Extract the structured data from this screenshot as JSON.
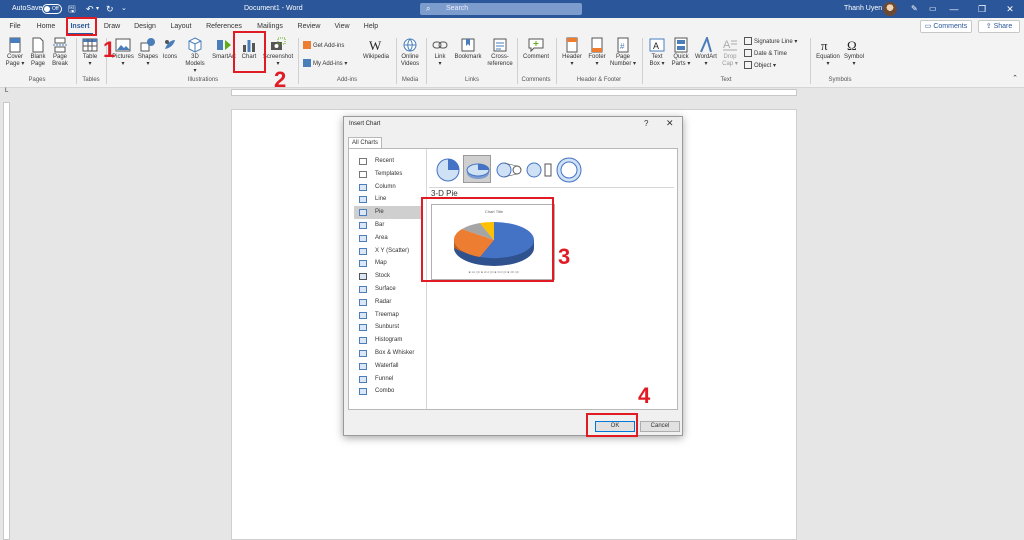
{
  "titlebar": {
    "autosave_label": "AutoSave",
    "autosave_state": "Off",
    "document_title": "Document1 - Word",
    "search_placeholder": "Search",
    "user_name": "Thanh Uyen"
  },
  "tabs": [
    {
      "label": "File"
    },
    {
      "label": "Home"
    },
    {
      "label": "Insert"
    },
    {
      "label": "Draw"
    },
    {
      "label": "Design"
    },
    {
      "label": "Layout"
    },
    {
      "label": "References"
    },
    {
      "label": "Mailings"
    },
    {
      "label": "Review"
    },
    {
      "label": "View"
    },
    {
      "label": "Help"
    }
  ],
  "top_buttons": {
    "comments": "Comments",
    "share": "Share"
  },
  "ribbon": {
    "pages": {
      "cover": "Cover",
      "cover2": "Page",
      "blank": "Blank",
      "blank2": "Page",
      "break": "Page",
      "break2": "Break",
      "label": "Pages"
    },
    "tables": {
      "table": "Table",
      "label": "Tables"
    },
    "illustrations": {
      "pictures": "Pictures",
      "shapes": "Shapes",
      "icons": "Icons",
      "models": "3D",
      "models2": "Models",
      "smartart": "SmartArt",
      "chart": "Chart",
      "screenshot": "Screenshot",
      "label": "Illustrations"
    },
    "addins": {
      "get": "Get Add-ins",
      "my": "My Add-ins",
      "wikipedia": "Wikipedia",
      "label": "Add-ins"
    },
    "media": {
      "online": "Online",
      "online2": "Videos",
      "label": "Media"
    },
    "links": {
      "link": "Link",
      "bookmark": "Bookmark",
      "cross": "Cross-",
      "cross2": "reference",
      "label": "Links"
    },
    "comments": {
      "comment": "Comment",
      "label": "Comments"
    },
    "headerfooter": {
      "header": "Header",
      "footer": "Footer",
      "page": "Page",
      "page2": "Number",
      "label": "Header & Footer"
    },
    "text": {
      "textbox": "Text",
      "textbox2": "Box",
      "quick": "Quick",
      "quick2": "Parts",
      "wordart": "WordArt",
      "drop": "Drop",
      "drop2": "Cap",
      "sigline": "Signature Line",
      "datetime": "Date & Time",
      "object": "Object",
      "label": "Text"
    },
    "symbols": {
      "equation": "Equation",
      "symbol": "Symbol",
      "label": "Symbols"
    }
  },
  "dialog": {
    "title": "Insert Chart",
    "help": "?",
    "close": "✕",
    "tab": "All Charts",
    "chart_types": [
      {
        "label": "Recent",
        "icon": "recent-icon"
      },
      {
        "label": "Templates",
        "icon": "templates-icon"
      },
      {
        "label": "Column",
        "icon": "column-chart-icon"
      },
      {
        "label": "Line",
        "icon": "line-chart-icon"
      },
      {
        "label": "Pie",
        "icon": "pie-chart-icon"
      },
      {
        "label": "Bar",
        "icon": "bar-chart-icon"
      },
      {
        "label": "Area",
        "icon": "area-chart-icon"
      },
      {
        "label": "X Y (Scatter)",
        "icon": "scatter-chart-icon"
      },
      {
        "label": "Map",
        "icon": "map-chart-icon"
      },
      {
        "label": "Stock",
        "icon": "stock-chart-icon"
      },
      {
        "label": "Surface",
        "icon": "surface-chart-icon"
      },
      {
        "label": "Radar",
        "icon": "radar-chart-icon"
      },
      {
        "label": "Treemap",
        "icon": "treemap-chart-icon"
      },
      {
        "label": "Sunburst",
        "icon": "sunburst-chart-icon"
      },
      {
        "label": "Histogram",
        "icon": "histogram-chart-icon"
      },
      {
        "label": "Box & Whisker",
        "icon": "box-whisker-chart-icon"
      },
      {
        "label": "Waterfall",
        "icon": "waterfall-chart-icon"
      },
      {
        "label": "Funnel",
        "icon": "funnel-chart-icon"
      },
      {
        "label": "Combo",
        "icon": "combo-chart-icon"
      }
    ],
    "selected_type": "Pie",
    "subtype_label": "3-D Pie",
    "preview_title": "Chart Title",
    "preview_legend": "■ 1st Qtr  ■ 2nd Qtr  ■ 3rd Qtr  ■ 4th Qtr",
    "ok": "OK",
    "cancel": "Cancel"
  },
  "annotations": {
    "step1": "1",
    "step2": "2",
    "step3": "3",
    "step4": "4"
  },
  "colors": {
    "accent": "#2b579a",
    "annotation": "#e01b24",
    "pie_blue": "#4472c4",
    "pie_orange": "#ed7d31",
    "pie_gray": "#a5a5a5",
    "pie_yellow": "#ffc000"
  }
}
